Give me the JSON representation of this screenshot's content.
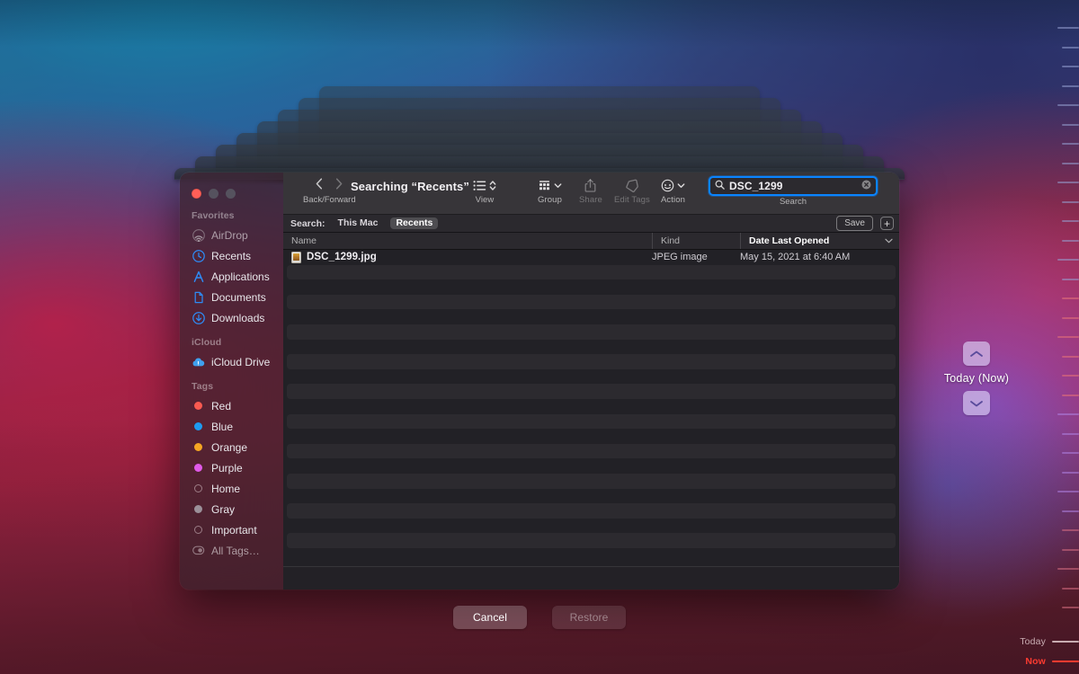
{
  "desktop": {
    "timeline": {
      "today_label": "Today",
      "now_label": "Now",
      "tick_count": 33
    },
    "time_machine_nav": {
      "up_icon": "chevron-up-icon",
      "down_icon": "chevron-down-icon",
      "current_snapshot": "Today (Now)"
    },
    "actions": {
      "cancel_label": "Cancel",
      "restore_label": "Restore"
    }
  },
  "finder": {
    "title": "Searching “Recents”",
    "traffic_lights": {
      "close": "close-button",
      "minimize": "minimize-button",
      "maximize": "maximize-button"
    },
    "toolbar": {
      "nav_caption": "Back/Forward",
      "back_icon": "chevron-left-icon",
      "forward_icon": "chevron-right-icon",
      "items": [
        {
          "caption": "View",
          "icon": "list-view-icon",
          "disabled": false
        },
        {
          "caption": "Group",
          "icon": "group-grid-icon",
          "disabled": false
        },
        {
          "caption": "Share",
          "icon": "share-icon",
          "disabled": true
        },
        {
          "caption": "Edit Tags",
          "icon": "tag-icon",
          "disabled": true
        },
        {
          "caption": "Action",
          "icon": "action-icon",
          "disabled": false
        }
      ]
    },
    "search": {
      "caption": "Search",
      "value": "DSC_1299",
      "placeholder": "Search",
      "search_icon": "magnifier-icon",
      "clear_icon": "clear-circle-icon",
      "focused": true,
      "accent": "#0a84ff"
    },
    "scope_bar": {
      "label": "Search:",
      "scopes": [
        {
          "label": "This Mac",
          "active": false
        },
        {
          "label": "Recents",
          "active": true
        }
      ],
      "save_label": "Save",
      "add_label": "+"
    },
    "columns": [
      {
        "key": "name",
        "label": "Name",
        "sorted": false
      },
      {
        "key": "kind",
        "label": "Kind",
        "sorted": false
      },
      {
        "key": "date",
        "label": "Date Last Opened",
        "sorted": true
      }
    ],
    "sort_chevron_icon": "chevron-down-icon",
    "files": [
      {
        "name": "DSC_1299.jpg",
        "kind": "JPEG image",
        "date": "May 15, 2021 at 6:40 AM",
        "icon": "jpeg-file-icon"
      }
    ],
    "empty_row_count": 19,
    "sidebar": {
      "groups": [
        {
          "header": "Favorites",
          "items": [
            {
              "label": "AirDrop",
              "icon": "airdrop-icon",
              "dim": true
            },
            {
              "label": "Recents",
              "icon": "clock-icon",
              "dim": false
            },
            {
              "label": "Applications",
              "icon": "applications-icon",
              "dim": false
            },
            {
              "label": "Documents",
              "icon": "document-icon",
              "dim": false
            },
            {
              "label": "Downloads",
              "icon": "downloads-icon",
              "dim": false
            }
          ]
        },
        {
          "header": "iCloud",
          "items": [
            {
              "label": "iCloud Drive",
              "icon": "cloud-icon",
              "dim": false
            }
          ]
        },
        {
          "header": "Tags",
          "items": [
            {
              "label": "Red",
              "icon": "tag-dot-icon",
              "color": "#fa5a50",
              "filled": true
            },
            {
              "label": "Blue",
              "icon": "tag-dot-icon",
              "color": "#1e9bf0",
              "filled": true
            },
            {
              "label": "Orange",
              "icon": "tag-dot-icon",
              "color": "#f5a623",
              "filled": true
            },
            {
              "label": "Purple",
              "icon": "tag-dot-icon",
              "color": "#e05ae8",
              "filled": true
            },
            {
              "label": "Home",
              "icon": "tag-dot-icon",
              "color": "",
              "filled": false
            },
            {
              "label": "Gray",
              "icon": "tag-dot-icon",
              "color": "#9b9099",
              "filled": true
            },
            {
              "label": "Important",
              "icon": "tag-dot-icon",
              "color": "",
              "filled": false
            },
            {
              "label": "All Tags…",
              "icon": "all-tags-icon",
              "color": "",
              "filled": false,
              "dim": true
            }
          ]
        }
      ]
    }
  }
}
